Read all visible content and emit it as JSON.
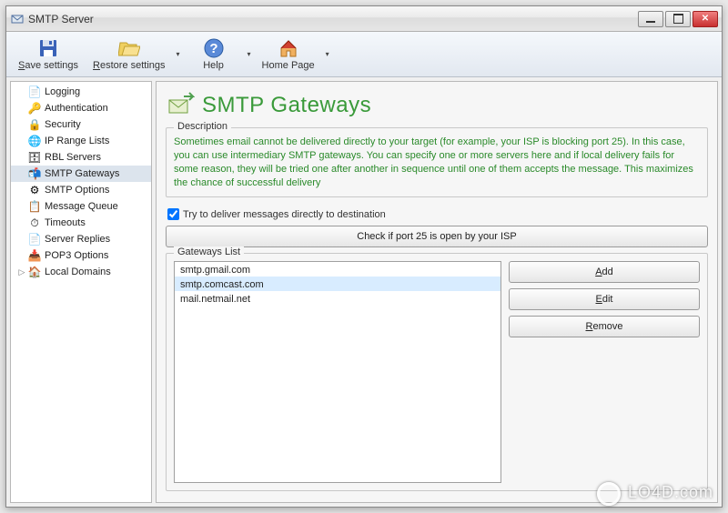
{
  "window": {
    "title": "SMTP Server"
  },
  "toolbar": {
    "save_label": "Save settings",
    "restore_label": "Restore settings",
    "help_label": "Help",
    "home_label": "Home Page"
  },
  "sidebar": {
    "items": [
      {
        "label": "Logging",
        "icon": "📝",
        "selected": false
      },
      {
        "label": "Authentication",
        "icon": "🔑",
        "selected": false
      },
      {
        "label": "Security",
        "icon": "🔒",
        "selected": false
      },
      {
        "label": "IP Range Lists",
        "icon": "🌐",
        "selected": false
      },
      {
        "label": "RBL Servers",
        "icon": "🗄",
        "selected": false
      },
      {
        "label": "SMTP Gateways",
        "icon": "📬",
        "selected": true
      },
      {
        "label": "SMTP Options",
        "icon": "⚙",
        "selected": false
      },
      {
        "label": "Message Queue",
        "icon": "📋",
        "selected": false
      },
      {
        "label": "Timeouts",
        "icon": "⏱",
        "selected": false
      },
      {
        "label": "Server Replies",
        "icon": "📄",
        "selected": false
      },
      {
        "label": "POP3 Options",
        "icon": "📥",
        "selected": false
      },
      {
        "label": "Local Domains",
        "icon": "🏠",
        "selected": false,
        "expandable": true
      }
    ]
  },
  "page": {
    "title": "SMTP Gateways",
    "desc_group": "Description",
    "description": "Sometimes email cannot be delivered directly to your target (for example, your ISP is blocking port 25). In this case, you can use intermediary SMTP gateways. You can specify one or more servers here and if local delivery fails for some reason, they will be tried one after another in sequence until one of them accepts the message. This maximizes the chance of successful delivery",
    "direct_checkbox_label": "Try to deliver messages directly to destination",
    "direct_checked": true,
    "check_port_btn": "Check if port 25 is open by your ISP",
    "gateways_group": "Gateways List",
    "gateways": [
      {
        "host": "smtp.gmail.com",
        "selected": false
      },
      {
        "host": "smtp.comcast.com",
        "selected": true
      },
      {
        "host": "mail.netmail.net",
        "selected": false
      }
    ],
    "buttons": {
      "add": "Add",
      "edit": "Edit",
      "remove": "Remove"
    }
  },
  "watermark": "LO4D.com"
}
